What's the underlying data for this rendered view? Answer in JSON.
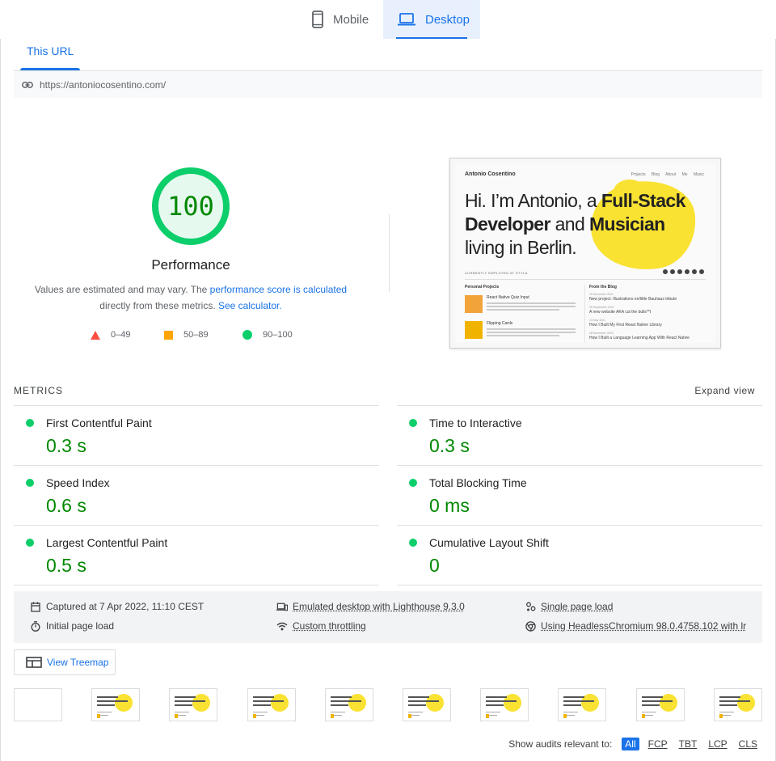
{
  "device_tabs": {
    "mobile_label": "Mobile",
    "desktop_label": "Desktop",
    "active": "Desktop"
  },
  "url_tab": {
    "label": "This URL",
    "url": "https://antoniocosentino.com/"
  },
  "performance": {
    "score": "100",
    "title": "Performance",
    "desc_prefix": "Values are estimated and may vary. The ",
    "desc_link": "performance score is calculated",
    "desc_mid": "directly from these metrics. ",
    "desc_link2": "See calculator.",
    "gauge_color": "#0cce6b",
    "score_color": "#008800"
  },
  "legend": [
    {
      "range": "0–49",
      "shape": "triangle",
      "color": "#ff4e42"
    },
    {
      "range": "50–89",
      "shape": "square",
      "color": "#ffa400"
    },
    {
      "range": "90–100",
      "shape": "circle",
      "color": "#0cce6b"
    }
  ],
  "screenshot": {
    "brand": "Antonio Cosentino",
    "nav": "Projects Blog About Me Music",
    "hero_a": "Hi. I’m Antonio, a ",
    "hero_b": "Full-Stack",
    "hero_c": "Developer",
    "hero_d": " and ",
    "hero_e": "Musician",
    "hero_f": "living in Berlin.",
    "employed": "CURRENTLY EMPLOYED AT STYLA",
    "projects_title": "Personal Projects",
    "blog_title": "From the Blog",
    "projects": [
      "React Native Quiz Input",
      "Flipping Cards"
    ],
    "blog_posts": [
      {
        "date": "10 December 2021",
        "title": "New project: Illustrations en/little Bauhaus tribute"
      },
      {
        "date": "06 September 2021",
        "title": "A new website AKA cut the bulls**t"
      },
      {
        "date": "13 May 2021",
        "title": "How I Built My First React Native Library"
      },
      {
        "date": "28 November 2020",
        "title": "How I Built a Language Learning App With React Native"
      }
    ]
  },
  "metrics": {
    "heading": "METRICS",
    "expand_label": "Expand view",
    "items": [
      {
        "name": "First Contentful Paint",
        "value": "0.3 s"
      },
      {
        "name": "Time to Interactive",
        "value": "0.3 s"
      },
      {
        "name": "Speed Index",
        "value": "0.6 s"
      },
      {
        "name": "Total Blocking Time",
        "value": "0 ms"
      },
      {
        "name": "Largest Contentful Paint",
        "value": "0.5 s"
      },
      {
        "name": "Cumulative Layout Shift",
        "value": "0"
      }
    ],
    "status_color": "#0cce6b"
  },
  "environment": {
    "captured": "Captured at 7 Apr 2022, 11:10 CEST",
    "initial_load": "Initial page load",
    "emulated": "Emulated desktop with Lighthouse 9.3.0",
    "throttling": "Custom throttling",
    "single_page": "Single page load",
    "browser": "Using HeadlessChromium 98.0.4758.102 with lr"
  },
  "treemap_label": "View Treemap",
  "audit_filter": {
    "label": "Show audits relevant to:",
    "chips": [
      "All",
      "FCP",
      "TBT",
      "LCP",
      "CLS"
    ],
    "active": "All"
  }
}
